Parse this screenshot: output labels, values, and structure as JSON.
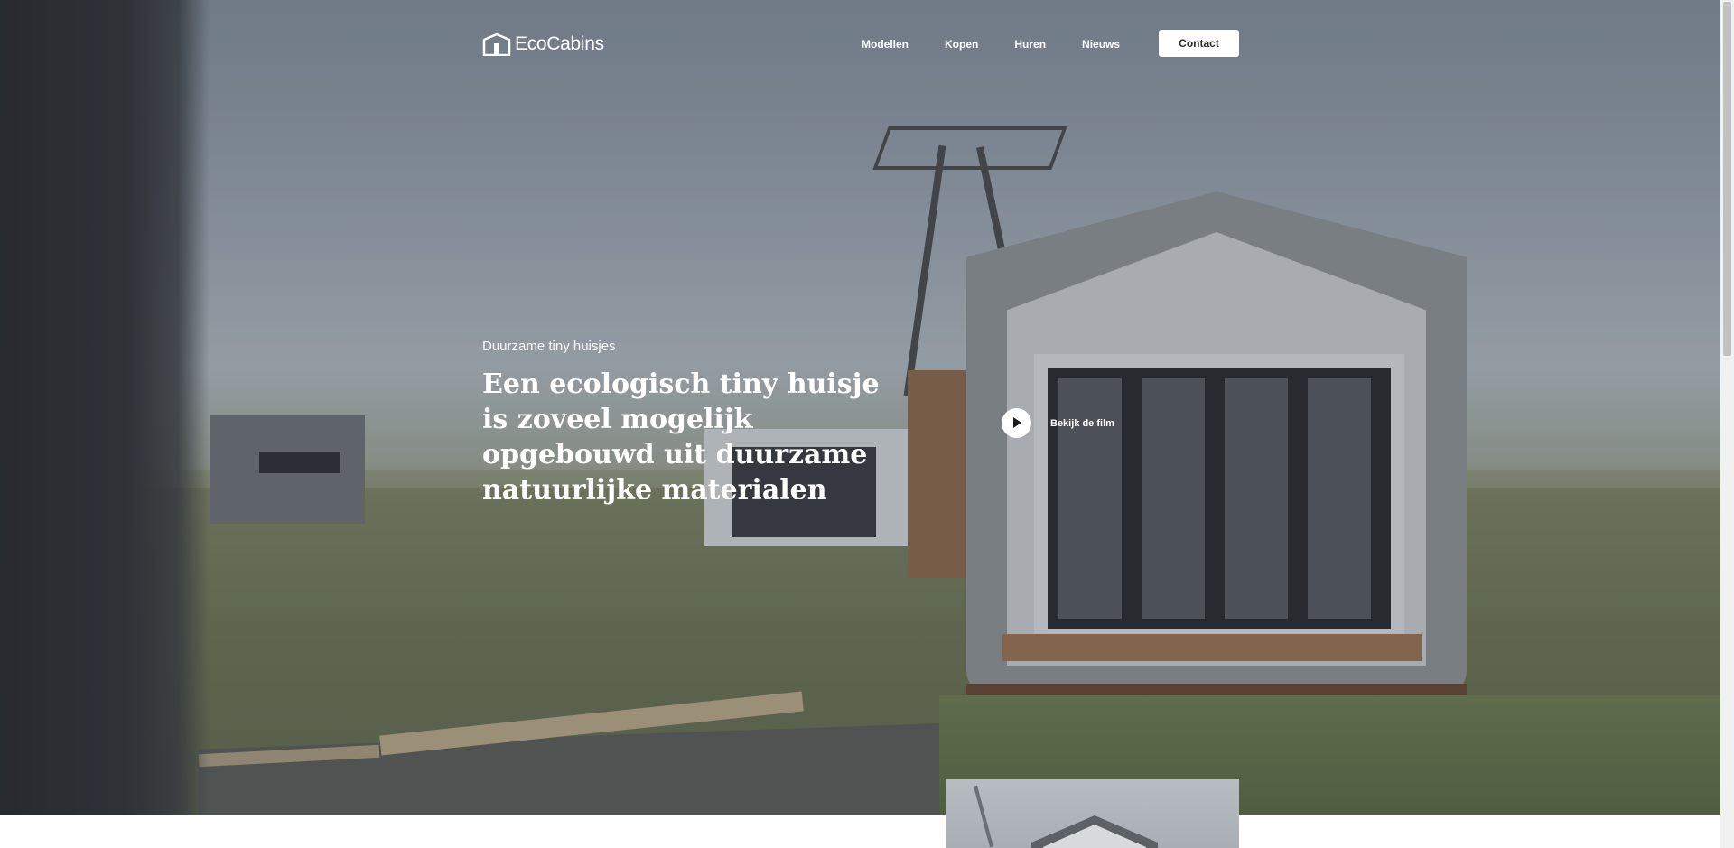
{
  "brand": {
    "name": "EcoCabins"
  },
  "nav": {
    "items": [
      {
        "label": "Modellen"
      },
      {
        "label": "Kopen"
      },
      {
        "label": "Huren"
      },
      {
        "label": "Nieuws"
      }
    ],
    "contact_label": "Contact"
  },
  "hero": {
    "eyebrow": "Duurzame tiny huisjes",
    "headline": "Een ecologisch tiny huisje is zoveel mogelijk opgebouwd uit duurzame natuurlijke materialen",
    "video_label": "Bekijk de film"
  },
  "icons": {
    "logo": "house-logo-icon",
    "play": "play-icon"
  },
  "colors": {
    "text_on_hero": "#ffffff",
    "button_bg": "#ffffff",
    "button_text": "#2b2b2b"
  }
}
